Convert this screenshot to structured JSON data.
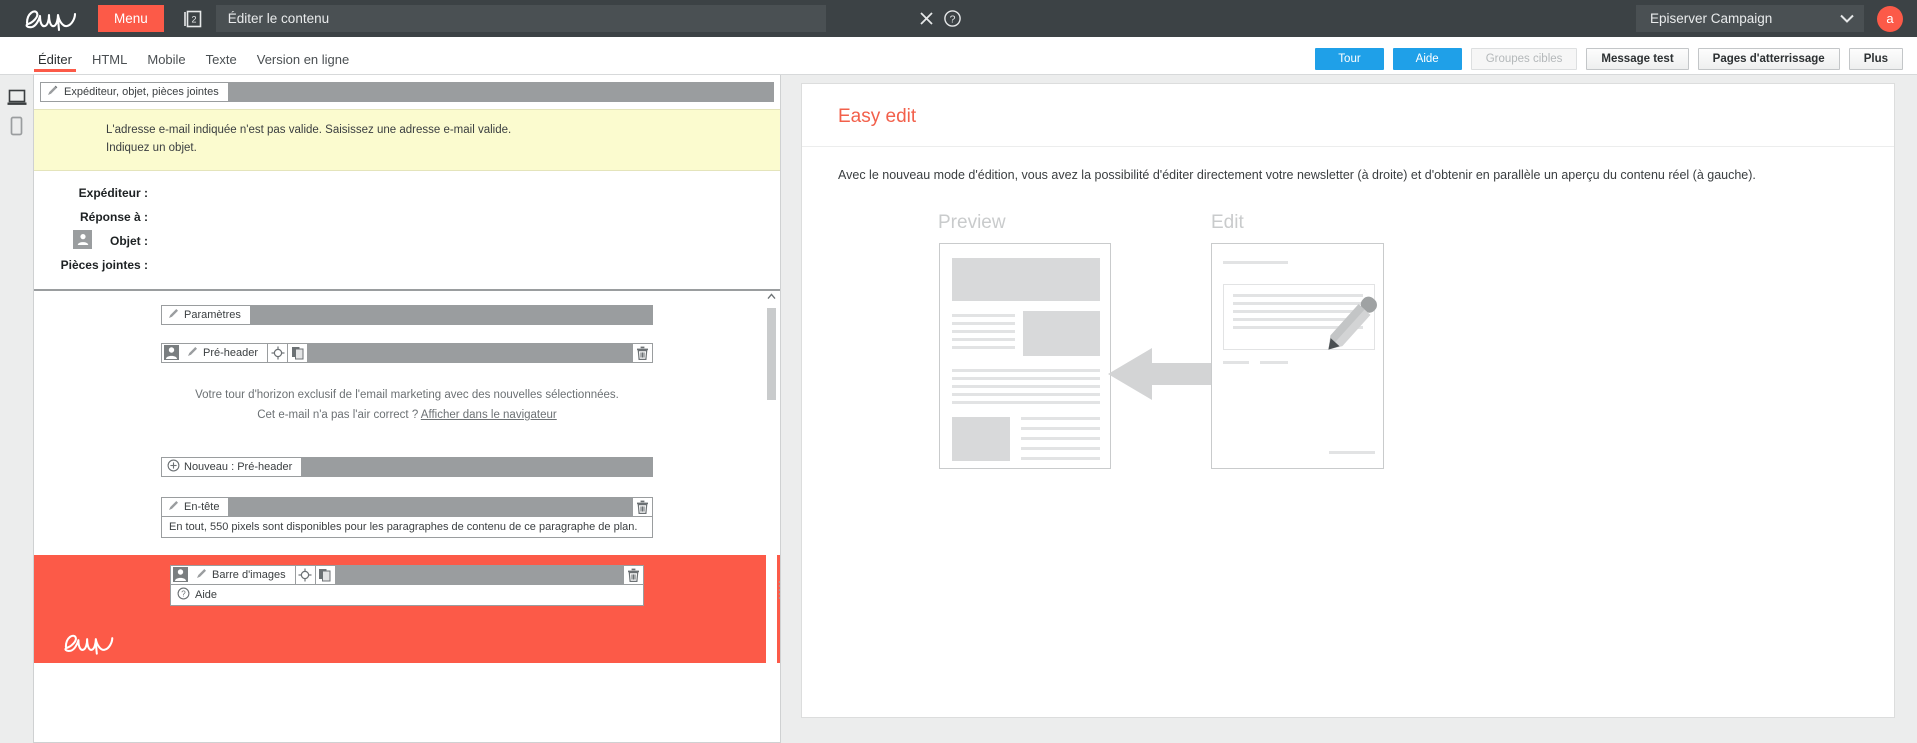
{
  "topbar": {
    "logo": "epi-logo",
    "menu_label": "Menu",
    "doc_badge": "2",
    "title": "Éditer le contenu",
    "close_icon": "close-icon",
    "help_icon": "help-circle-icon",
    "client": "Episerver Campaign",
    "chevron_icon": "chevron-down-icon",
    "avatar_initial": "a",
    "accent_color": "#fc5a48",
    "bar_color": "#3c4245"
  },
  "tabs": [
    {
      "label": "Éditer",
      "active": true
    },
    {
      "label": "HTML",
      "active": false
    },
    {
      "label": "Mobile",
      "active": false
    },
    {
      "label": "Texte",
      "active": false
    },
    {
      "label": "Version en ligne",
      "active": false
    }
  ],
  "actions": [
    {
      "label": "Tour",
      "style": "blue",
      "disabled": false
    },
    {
      "label": "Aide",
      "style": "blue",
      "disabled": false
    },
    {
      "label": "Groupes cibles",
      "style": "plain",
      "disabled": true
    },
    {
      "label": "Message test",
      "style": "plain",
      "disabled": false
    },
    {
      "label": "Pages d'atterrissage",
      "style": "plain",
      "disabled": false
    },
    {
      "label": "Plus",
      "style": "plain",
      "disabled": false
    }
  ],
  "rail": [
    {
      "icon": "desktop-preview-icon",
      "active": true
    },
    {
      "icon": "mobile-preview-icon",
      "active": false
    }
  ],
  "editor": {
    "header_bar": {
      "icon": "pencil-icon",
      "label": "Expéditeur, objet, pièces jointes"
    },
    "warning": {
      "line1": "L'adresse e-mail indiquée n'est pas valide. Saisissez une adresse e-mail valide.",
      "line2": "Indiquez un objet.",
      "background": "#fbfbcf"
    },
    "fields": [
      {
        "label": "Expéditeur :",
        "value": ""
      },
      {
        "label": "Réponse à :",
        "value": ""
      },
      {
        "label": "Objet :",
        "value": ""
      },
      {
        "label": "Pièces jointes :",
        "value": ""
      }
    ],
    "person_badge_icon": "person-icon",
    "modules": [
      {
        "id": "parametres",
        "type": "bar",
        "icon": "pencil-icon",
        "label": "Paramètres",
        "has_person": false,
        "has_target": false,
        "has_copy": false,
        "has_trash": false
      },
      {
        "id": "pre-header",
        "type": "bar",
        "icon": "pencil-icon",
        "label": "Pré-header",
        "has_person": true,
        "has_target": true,
        "has_copy": true,
        "has_trash": true
      },
      {
        "id": "pre-header-text",
        "type": "text",
        "line1": "Votre tour d'horizon exclusif de l'email marketing avec des nouvelles sélectionnées.",
        "line2_prefix": "Cet e-mail n'a pas l'air correct ? ",
        "line2_link": "Afficher dans le navigateur"
      },
      {
        "id": "nouveau-pre-header",
        "type": "bar",
        "icon": "plus-circle-icon",
        "label": "Nouveau : Pré-header",
        "has_person": false,
        "has_target": false,
        "has_copy": false,
        "has_trash": false
      },
      {
        "id": "en-tete",
        "type": "bar-with-text",
        "icon": "pencil-icon",
        "label": "En-tête",
        "has_trash": true,
        "body": "En tout, 550 pixels sont disponibles pour les paragraphes de contenu de ce paragraphe de plan."
      },
      {
        "id": "barre-d-images",
        "type": "red-block",
        "icon": "pencil-icon",
        "label": "Barre d'images",
        "has_person": true,
        "has_target": true,
        "has_copy": true,
        "has_trash": true,
        "help_icon": "help-circle-icon",
        "help_label": "Aide",
        "block_color": "#fc5a48",
        "logo": "epi-logo-white"
      }
    ],
    "scroll": {
      "up_arrow": "chevron-up-icon",
      "gripper": "resize-gripper-icon"
    }
  },
  "preview": {
    "title": "Easy edit",
    "title_color": "#f2604b",
    "body": "Avec le nouveau mode d'édition, vous avez la possibilité d'éditer directement votre newsletter (à droite) et d'obtenir en parallèle un aperçu du contenu réel (à gauche).",
    "diagram": {
      "left_label": "Preview",
      "right_label": "Edit",
      "arrow_icon": "arrow-left-icon",
      "pencil_icon": "pencil-icon"
    }
  }
}
